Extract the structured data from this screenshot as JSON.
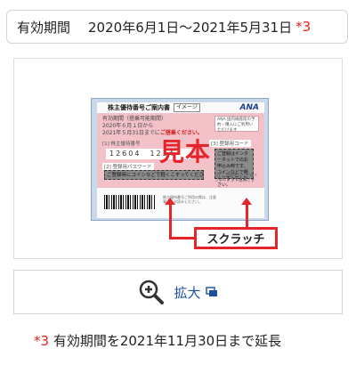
{
  "period": {
    "label": "有効期間",
    "range": "2020年6月1日〜2021年5月31日",
    "note_mark": "*3"
  },
  "sample_image": {
    "title": "株主優待番号ご案内書",
    "image_tag": "イメージ",
    "logo": "ANA",
    "valid_label": "有効期間（搭乗可能期間）",
    "valid_from": "2020年６月１日から",
    "valid_to_prefix": "2021年５月31日までに",
    "valid_to_emphasis": "ご搭乗ください。",
    "ana_note": "ANA 国内線座席の予約・購入にご利用いただけます",
    "section1": "[1] 株主優待番号",
    "number": "12604　1234",
    "section2": "[2] 登録用パスワード",
    "scratch_bar_text": "ご登録時にコインなどで軽くこすってください。",
    "section3": "[3] 登録用コード",
    "scratch_box_text": "ご登録はインターネットでのお申込み時です。コインなどで軽くこすってください。",
    "stamp": "見本",
    "small_note": "株主優待番号ご利用の際は、注意事項をお読みください。",
    "right_note": "[3] ご登録用コードはインターネット専用です",
    "scratch_label": "スクラッチ"
  },
  "zoom_button": {
    "label": "拡大"
  },
  "footnote": {
    "mark": "*3",
    "text": " 有効期間を2021年11月30日まで延長"
  },
  "colors": {
    "accent_red": "#e2231a",
    "link_blue": "#1d4f9c"
  }
}
